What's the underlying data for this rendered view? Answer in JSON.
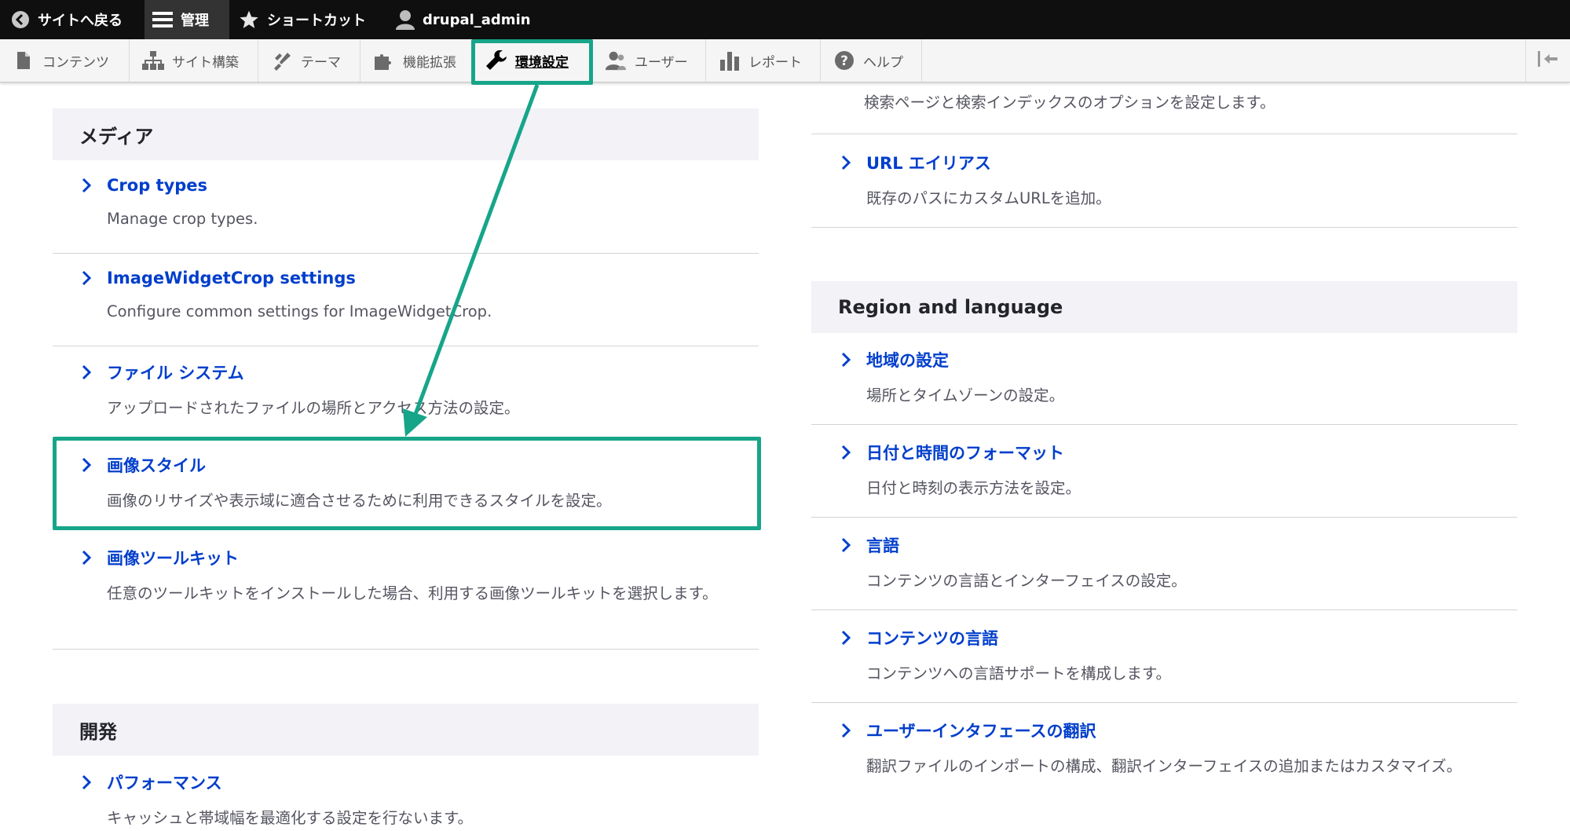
{
  "toolbar": {
    "back_label": "サイトへ戻る",
    "manage_label": "管理",
    "shortcuts_label": "ショートカット",
    "user_label": "drupal_admin"
  },
  "tray": {
    "items": [
      {
        "label": "コンテンツ",
        "icon": "file-icon"
      },
      {
        "label": "サイト構築",
        "icon": "sitemap-icon"
      },
      {
        "label": "テーマ",
        "icon": "paintbrush-icon"
      },
      {
        "label": "機能拡張",
        "icon": "puzzle-icon"
      },
      {
        "label": "環境設定",
        "icon": "wrench-icon"
      },
      {
        "label": "ユーザー",
        "icon": "people-icon"
      },
      {
        "label": "レポート",
        "icon": "bar-chart-icon"
      },
      {
        "label": "ヘルプ",
        "icon": "help-icon"
      }
    ],
    "current_index": 4
  },
  "left": {
    "media": {
      "title": "メディア",
      "items": [
        {
          "label": "Crop types",
          "desc": "Manage crop types."
        },
        {
          "label": "ImageWidgetCrop settings",
          "desc": "Configure common settings for ImageWidgetCrop."
        },
        {
          "label": "ファイル システム",
          "desc": "アップロードされたファイルの場所とアクセス方法の設定。"
        },
        {
          "label": "画像スタイル",
          "desc": "画像のリサイズや表示域に適合させるために利用できるスタイルを設定。"
        },
        {
          "label": "画像ツールキット",
          "desc": "任意のツールキットをインストールした場合、利用する画像ツールキットを選択します。"
        }
      ]
    },
    "dev": {
      "title": "開発",
      "items": [
        {
          "label": "パフォーマンス",
          "desc": "キャッシュと帯域幅を最適化する設定を行ないます。"
        }
      ]
    }
  },
  "right": {
    "search_desc": "検索ページと検索インデックスのオプションを設定します。",
    "url_alias": {
      "label": "URL エイリアス",
      "desc": "既存のパスにカスタムURLを追加。"
    },
    "region": {
      "title": "Region and language",
      "items": [
        {
          "label": "地域の設定",
          "desc": "場所とタイムゾーンの設定。"
        },
        {
          "label": "日付と時間のフォーマット",
          "desc": "日付と時刻の表示方法を設定。"
        },
        {
          "label": "言語",
          "desc": "コンテンツの言語とインターフェイスの設定。"
        },
        {
          "label": "コンテンツの言語",
          "desc": "コンテンツへの言語サポートを構成します。"
        },
        {
          "label": "ユーザーインタフェースの翻訳",
          "desc": "翻訳ファイルのインポートの構成、翻訳インターフェイスの追加またはカスタマイズ。"
        }
      ]
    }
  },
  "colors": {
    "link": "#003ecc",
    "annotation": "#17a589",
    "toolbar_bg": "#0f0f0f"
  }
}
